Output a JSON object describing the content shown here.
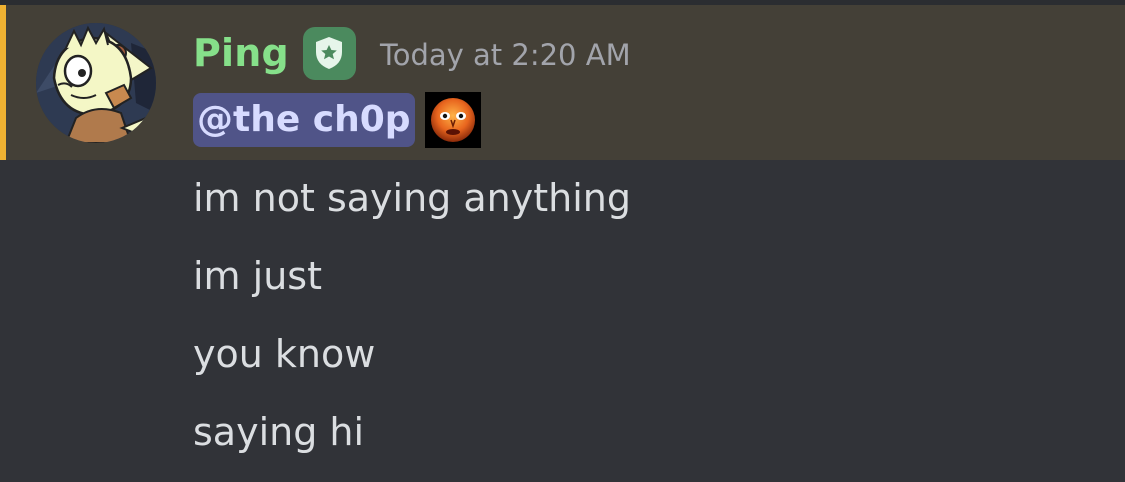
{
  "message": {
    "author": {
      "name": "Ping",
      "name_color": "#86e08a",
      "badge_icon": "shield-star-icon",
      "avatar": "cartoon-creature-avatar"
    },
    "timestamp": "Today at 2:20 AM",
    "mention": "@the ch0p",
    "emoji": "orange-face-emoji",
    "lines": [
      "im not saying anything",
      "im just",
      "you know",
      "saying hi"
    ]
  },
  "colors": {
    "background": "#313338",
    "mention_highlight": "#444037",
    "mention_bar": "#f0b232",
    "mention_pill": "#505488",
    "text": "#dbdee1",
    "timestamp": "#a2a4ab"
  }
}
